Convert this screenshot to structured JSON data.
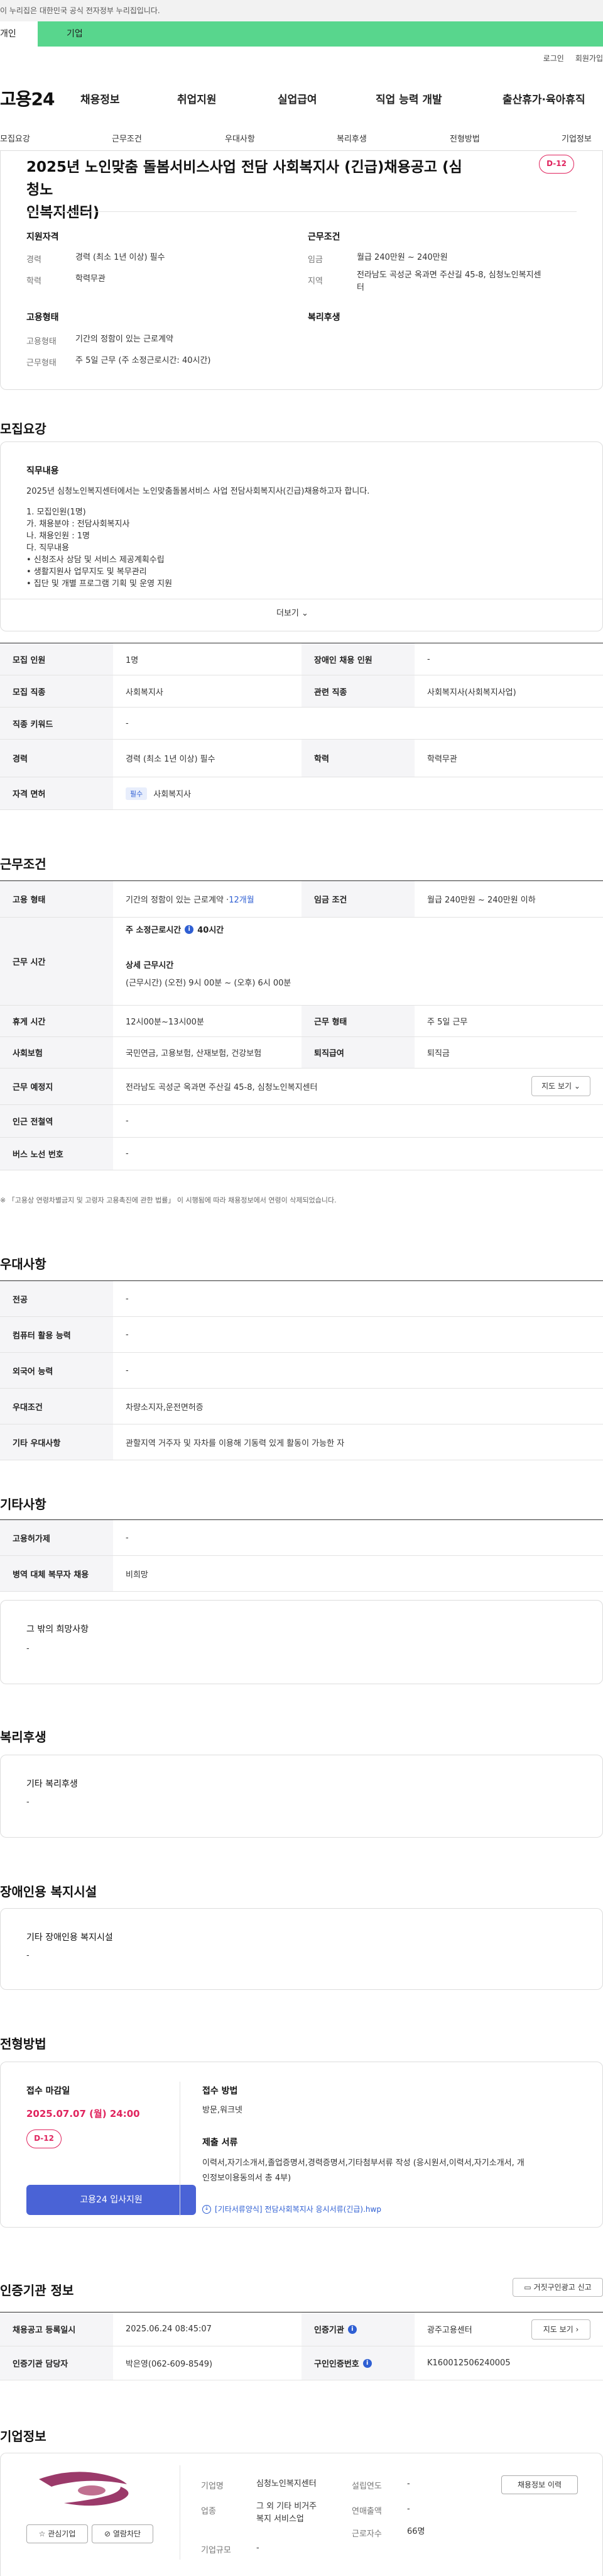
{
  "gov_banner": "이 누리집은 대한민국 공식 전자정부 누리집입니다.",
  "tabs": {
    "personal": "개인",
    "company": "기업"
  },
  "utility": {
    "login": "로그인",
    "signup": "회원가입"
  },
  "logo": "고용24",
  "gnb": [
    "채용정보",
    "취업지원",
    "실업급여",
    "직업 능력 개발",
    "출산휴가·육아휴직"
  ],
  "subnav": [
    "모집요강",
    "근무조건",
    "우대사항",
    "복리후생",
    "전형방법",
    "기업정보"
  ],
  "job": {
    "title_line1": "2025년 노인맞춤 돌봄서비스사업 전담 사회복지사 (긴급)채용공고 (심청노",
    "title_line2": "인복지센터)",
    "dday": "D-12",
    "qual_title": "지원자격",
    "exp_label": "경력",
    "exp_value": "경력 (최소 1년 이상) 필수",
    "edu_label": "학력",
    "edu_value": "학력무관",
    "work_title": "근무조건",
    "wage_label": "임금",
    "wage_value": "월급 240만원 ~ 240만원",
    "area_label": "지역",
    "area_value_1": "전라남도 곡성군 옥과면 주산길 45-8, 심청노인복지센",
    "area_value_2": "터",
    "emp_title": "고용형태",
    "emptype_label": "고용형태",
    "emptype_value": "기간의 정함이 있는 근로계약",
    "worktime_label": "근무형태",
    "worktime_value": "주 5일 근무 (주 소정근로시간: 40시간)",
    "welfare_title": "복리후생"
  },
  "recruit": {
    "title": "모집요강",
    "duty_title": "직무내용",
    "duty_lines": [
      "2025년 심청노인복지센터에서는 노인맞춤돌봄서비스 사업 전담사회복지사(긴급)채용하고자 합니다.",
      "",
      "1. 모집인원(1명)",
      "가. 채용분야 : 전담사회복지사",
      "나. 채용인원 : 1명",
      "다. 직무내용",
      "• 신청조사 상담 및 서비스 제공계획수립",
      "• 생활지원사 업무지도 및 복무관리",
      "• 집단 및 개별 프로그램 기획 및 운영 지원"
    ],
    "more": "더보기",
    "rows": {
      "count_label": "모집 인원",
      "count_value": "1명",
      "disabled_label": "장애인 채용 인원",
      "disabled_value": "-",
      "job_label": "모집 직종",
      "job_value": "사회복지사",
      "related_label": "관련 직종",
      "related_value": "사회복지사(사회복지사업)",
      "keyword_label": "직종 키워드",
      "keyword_value": "-",
      "career_label": "경력",
      "career_value": "경력 (최소 1년 이상) 필수",
      "edu_label": "학력",
      "edu_value": "학력무관",
      "license_label": "자격 면허",
      "license_badge": "필수",
      "license_value": "사회복지사"
    }
  },
  "conditions": {
    "title": "근무조건",
    "emptype_label": "고용 형태",
    "emptype_value": "기간의 정함이 있는 근로계약 · ",
    "emptype_period": "12개월",
    "wage_label": "임금 조건",
    "wage_value": "월급 240만원 ~ 240만원 이하",
    "time_label": "근무 시간",
    "std_hours_label": "주 소정근로시간",
    "std_hours_value": "40시간",
    "shift_title": "상세 근무시간",
    "shift_value": "(근무시간) (오전) 9시 00분 ~ (오후) 6시 00분",
    "break_label": "휴게 시간",
    "break_value": "12시00분~13시00분",
    "form_label": "근무 형태",
    "form_value": "주 5일 근무",
    "insurance_label": "사회보험",
    "insurance_value": "국민연금, 고용보험, 산재보험, 건강보험",
    "retire_label": "퇴직급여",
    "retire_value": "퇴직금",
    "place_label": "근무 예정지",
    "place_value": "전라남도 곡성군 옥과면 주산길 45-8, 심청노인복지센터",
    "map_btn": "지도 보기",
    "subway_label": "인근 전철역",
    "subway_value": "-",
    "bus_label": "버스 노선 번호",
    "bus_value": "-",
    "notice": "※ 「고용상 연령차별금지 및 고령자 고용촉진에 관한 법률」 이 시행됨에 따라 채용정보에서 연령이 삭제되었습니다."
  },
  "preference": {
    "title": "우대사항",
    "major_label": "전공",
    "major_value": "-",
    "computer_label": "컴퓨터 활용 능력",
    "computer_value": "-",
    "lang_label": "외국어 능력",
    "lang_value": "-",
    "cond_label": "우대조건",
    "cond_value": "차량소지자,운전면허증",
    "etc_label": "기타 우대사항",
    "etc_value": "관할지역 거주자 및 자차를 이용해 기동력 있게 활동이 가능한 자"
  },
  "others": {
    "title": "기타사항",
    "disabled_label": "고용허가제",
    "disabled_value": "-",
    "military_label": "병역 대체 복무자 채용",
    "military_value": "비희망",
    "wish_title": "그 밖의 희망사항",
    "wish_value": "-"
  },
  "welfare": {
    "title": "복리후생",
    "box_title": "기타 복리후생",
    "box_value": "-"
  },
  "disability": {
    "title": "장애인용 복지시설",
    "box_title": "기타 장애인용 복지시설",
    "box_value": "-"
  },
  "selection": {
    "title": "전형방법",
    "deadline_label": "접수 마감일",
    "deadline_value": "2025.07.07 (월) 24:00",
    "dday": "D-12",
    "apply_btn": "고용24 입사지원",
    "method_label": "접수 방법",
    "method_value": "방문,워크넷",
    "docs_label": "제출 서류",
    "docs_value_1": "이력서,자기소개서,졸업증명서,경력증명서,기타첨부서류 작성 (응시원서,이력서,자기소개서, 개",
    "docs_value_2": "인정보이용동의서 총 4부)",
    "file_link": "[기타서류양식] 전담사회복지사 응시서류(긴급).hwp"
  },
  "cert": {
    "title": "인증기관 정보",
    "report_btn": "거짓구인광고 신고",
    "reg_label": "채용공고 등록일시",
    "reg_value": "2025.06.24 08:45:07",
    "org_label": "인증기관",
    "org_value": "광주고용센터",
    "map_btn": "지도 보기",
    "manager_label": "인증기관 담당자",
    "manager_value": "박은영(062-609-8549)",
    "id_label": "구인인증번호",
    "id_value": "K160012506240005"
  },
  "company": {
    "title": "기업정보",
    "name_label": "기업명",
    "name_value": "심청노인복지센터",
    "industry_label": "업종",
    "industry_value_1": "그 외 기타 비거주",
    "industry_value_2": "복지 서비스업",
    "size_label": "기업규모",
    "size_value": "-",
    "founded_label": "설립연도",
    "founded_value": "-",
    "sales_label": "연매출액",
    "sales_value": "-",
    "staff_label": "근로자수",
    "staff_value": "66명",
    "fav_btn": "관심기업",
    "block_btn": "열람차단",
    "history_btn": "채용정보 이력"
  }
}
